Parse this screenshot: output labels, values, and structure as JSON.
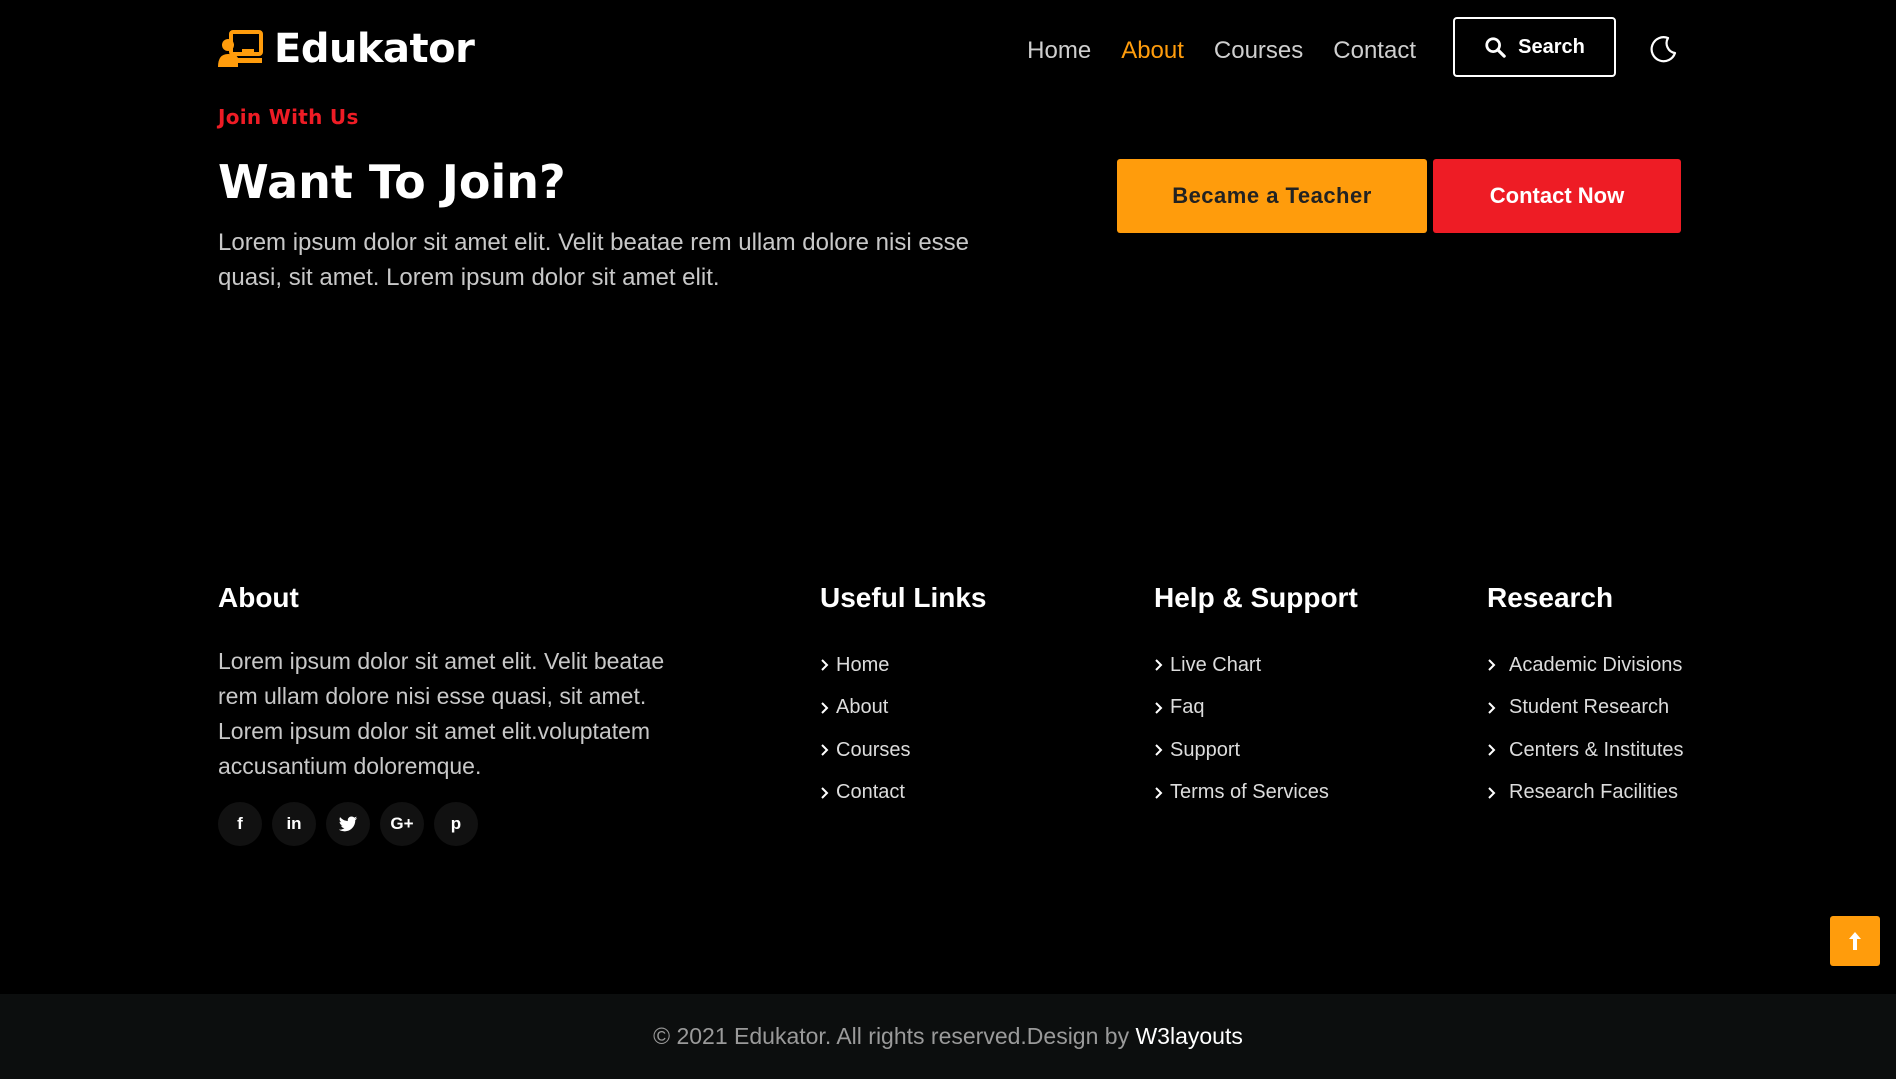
{
  "header": {
    "brand": "Edukator",
    "nav": [
      {
        "label": "Home",
        "active": false
      },
      {
        "label": "About",
        "active": true
      },
      {
        "label": "Courses",
        "active": false
      },
      {
        "label": "Contact",
        "active": false
      }
    ],
    "search_label": "Search",
    "theme_icon": "moon-icon"
  },
  "join": {
    "tag": "Join With Us",
    "title": "Want To Join?",
    "description": "Lorem ipsum dolor sit amet elit. Velit beatae rem ullam dolore nisi esse quasi, sit amet. Lorem ipsum dolor sit amet elit.",
    "teacher_button": "Became a Teacher",
    "contact_button": "Contact Now"
  },
  "footer": {
    "about": {
      "heading": "About",
      "text": "Lorem ipsum dolor sit amet elit. Velit beatae rem ullam dolore nisi esse quasi, sit amet. Lorem ipsum dolor sit amet elit.voluptatem accusantium doloremque.",
      "socials": [
        {
          "icon": "facebook-icon",
          "glyph": "f"
        },
        {
          "icon": "linkedin-icon",
          "glyph": "in"
        },
        {
          "icon": "twitter-icon",
          "glyph": "t"
        },
        {
          "icon": "google-plus-icon",
          "glyph": "G+"
        },
        {
          "icon": "pinterest-icon",
          "glyph": "p"
        }
      ]
    },
    "useful_links": {
      "heading": "Useful Links",
      "items": [
        "Home",
        "About",
        "Courses",
        "Contact"
      ]
    },
    "help_support": {
      "heading": "Help & Support",
      "items": [
        "Live Chart",
        "Faq",
        "Support",
        "Terms of Services"
      ]
    },
    "research": {
      "heading": "Research",
      "items": [
        "Academic Divisions",
        "Student Research",
        "Centers & Institutes",
        "Research Facilities"
      ]
    }
  },
  "copyright": {
    "text": "© 2021 Edukator. All rights reserved.Design by ",
    "link": "W3layouts"
  },
  "colors": {
    "accent": "#ff9c0c",
    "red": "#ee1c25",
    "background": "#000000",
    "footer_bottom": "#0c0e0e"
  }
}
